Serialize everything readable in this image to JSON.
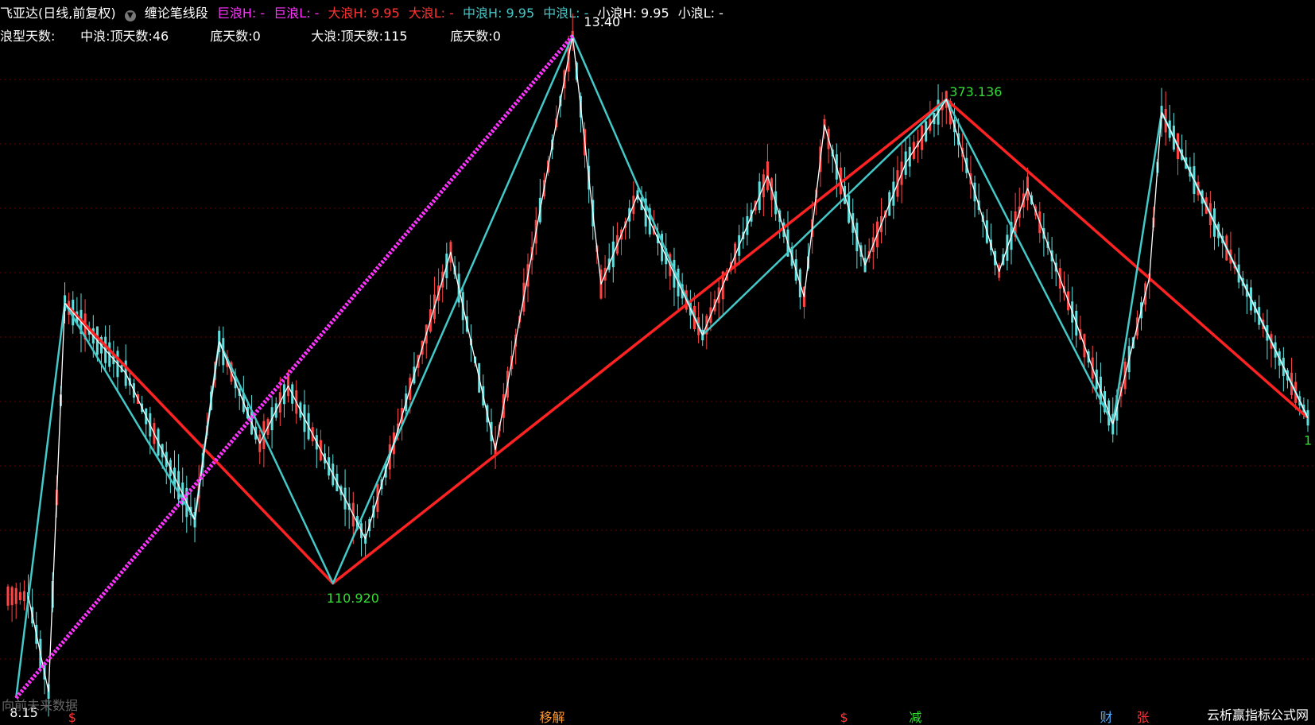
{
  "header": {
    "stock_name": "飞亚达(日线,前复权)",
    "indicator_icon": "circle-chevron-down-icon",
    "indicator_name": "缠论笔线段",
    "legend": [
      {
        "text": "巨浪H: -",
        "color": "#ff33ff"
      },
      {
        "text": "巨浪L: -",
        "color": "#ff33ff"
      },
      {
        "text": "大浪H: 9.95",
        "color": "#ff3333"
      },
      {
        "text": "大浪L: -",
        "color": "#ff3333"
      },
      {
        "text": "中浪H: 9.95",
        "color": "#44c8c8"
      },
      {
        "text": "中浪L: -",
        "color": "#44c8c8"
      },
      {
        "text": "小浪H: 9.95",
        "color": "#ffffff"
      },
      {
        "text": "小浪L: -",
        "color": "#ffffff"
      }
    ],
    "wave_days_label": "浪型天数:",
    "mid_wave_top": "中浪:顶天数:46",
    "mid_wave_bottom": "底天数:0",
    "big_wave_top": "大浪:顶天数:115",
    "big_wave_bottom": "底天数:0"
  },
  "chart_data": {
    "type": "line",
    "title": "飞亚达(日线,前复权) 缠论笔线段",
    "x_index_range": [
      0,
      320
    ],
    "colors": {
      "giant_wave": "#ff33ff",
      "big_wave": "#ff2222",
      "mid_wave": "#44c8c8",
      "small_wave": "#ffffff",
      "up_candle": "#ff4444",
      "down_candle": "#5fdede",
      "grid": "#6a0000",
      "price_label": "#33dd33"
    },
    "price_labels": [
      {
        "text": "13.40",
        "x": 141,
        "y": 13.4,
        "color": "#ffffff"
      },
      {
        "text": "373.136",
        "x": 231,
        "y": 12.85,
        "color": "#33dd33"
      },
      {
        "text": "110.920",
        "x": 80,
        "y": 9.05,
        "color": "#33dd33"
      },
      {
        "text": "8.15",
        "x": 2,
        "y": 8.15,
        "color": "#ffffff"
      },
      {
        "text": "1",
        "x": 320,
        "y": 10.35,
        "color": "#33dd33"
      }
    ],
    "series": [
      {
        "key": "giant",
        "style": "dotted",
        "points": [
          [
            2,
            8.15
          ],
          [
            139,
            13.35
          ]
        ]
      },
      {
        "key": "big",
        "style": "solid",
        "points": [
          [
            14,
            11.25
          ],
          [
            80,
            9.05
          ],
          [
            231,
            12.85
          ],
          [
            320,
            10.35
          ]
        ]
      },
      {
        "key": "mid",
        "style": "solid",
        "points": [
          [
            2,
            8.15
          ],
          [
            14,
            11.25
          ],
          [
            46,
            9.55
          ],
          [
            52,
            10.95
          ],
          [
            80,
            9.05
          ],
          [
            139,
            13.35
          ],
          [
            171,
            11.0
          ],
          [
            231,
            12.85
          ],
          [
            272,
            10.3
          ],
          [
            284,
            12.75
          ],
          [
            320,
            10.35
          ]
        ]
      },
      {
        "key": "small",
        "style": "solid",
        "points": [
          [
            5,
            8.95
          ],
          [
            10,
            8.2
          ],
          [
            14,
            11.25
          ],
          [
            29,
            10.7
          ],
          [
            46,
            9.55
          ],
          [
            52,
            10.95
          ],
          [
            62,
            10.15
          ],
          [
            69,
            10.6
          ],
          [
            88,
            9.4
          ],
          [
            109,
            11.65
          ],
          [
            120,
            10.1
          ],
          [
            139,
            13.35
          ],
          [
            146,
            11.4
          ],
          [
            155,
            12.1
          ],
          [
            171,
            11.0
          ],
          [
            187,
            12.25
          ],
          [
            196,
            11.3
          ],
          [
            201,
            12.65
          ],
          [
            211,
            11.55
          ],
          [
            221,
            12.35
          ],
          [
            231,
            12.85
          ],
          [
            244,
            11.5
          ],
          [
            251,
            12.15
          ],
          [
            272,
            10.3
          ],
          [
            281,
            11.45
          ],
          [
            284,
            12.75
          ],
          [
            320,
            10.35
          ]
        ]
      }
    ],
    "bottom_markers": [
      {
        "text": "$",
        "x": 16,
        "color": "#ff3333"
      },
      {
        "text": "移解",
        "x": 132,
        "color": "#ff9933"
      },
      {
        "text": "$",
        "x": 206,
        "color": "#ff3333"
      },
      {
        "text": "减",
        "x": 223,
        "color": "#33dd33"
      },
      {
        "text": "财",
        "x": 270,
        "color": "#55aaff"
      },
      {
        "text": "张",
        "x": 279,
        "color": "#ff3333"
      }
    ]
  },
  "footer": {
    "faded_text": "向前未来数据",
    "watermark": "云析赢指标公式网"
  }
}
